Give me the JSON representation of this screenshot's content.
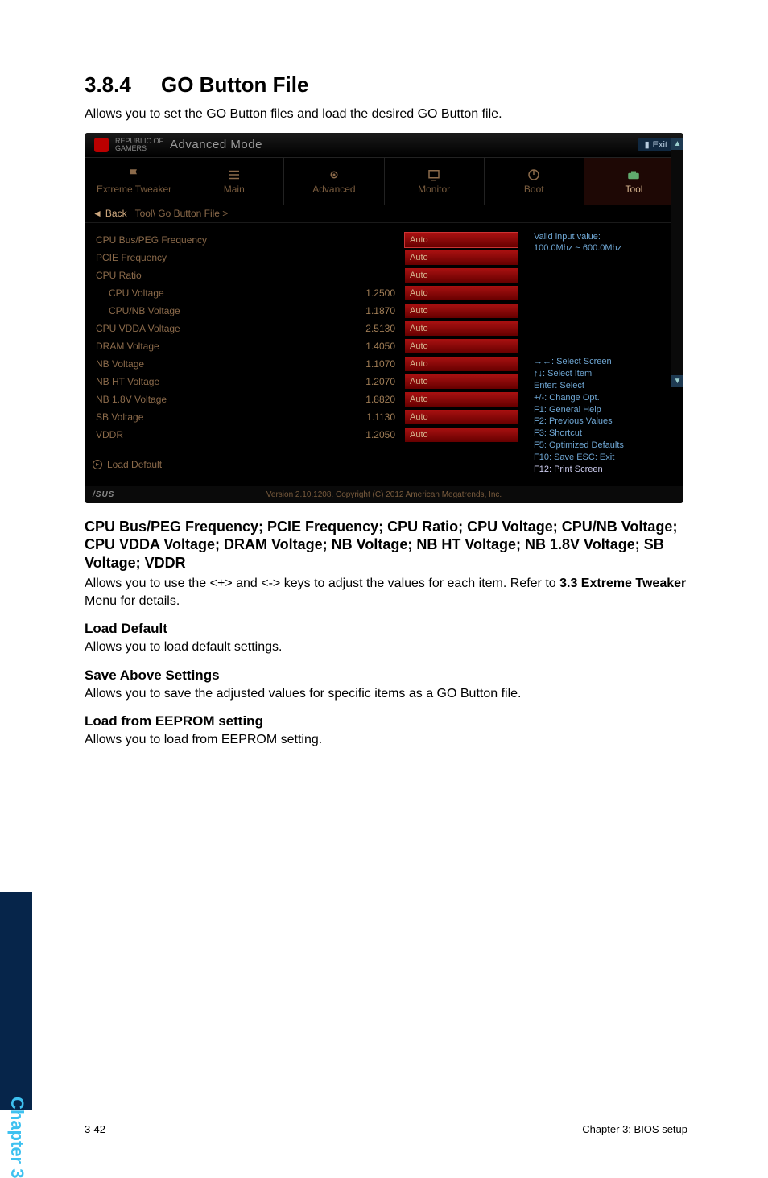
{
  "section_number": "3.8.4",
  "section_title": "GO Button File",
  "intro_text": "Allows you to set the GO Button files and load the desired GO Button file.",
  "bios": {
    "brand_line1": "REPUBLIC OF",
    "brand_line2": "GAMERS",
    "mode_label": "Advanced Mode",
    "exit_label": "Exit",
    "menu": {
      "extreme_tweaker": "Extreme Tweaker",
      "main": "Main",
      "advanced": "Advanced",
      "monitor": "Monitor",
      "boot": "Boot",
      "tool": "Tool"
    },
    "back_label": "Back",
    "breadcrumb": "Tool\\ Go Button File >",
    "rows": [
      {
        "label": "CPU Bus/PEG Frequency",
        "value": "",
        "field": "Auto",
        "indent": false,
        "active": true
      },
      {
        "label": "PCIE Frequency",
        "value": "",
        "field": "Auto",
        "indent": false
      },
      {
        "label": "CPU Ratio",
        "value": "",
        "field": "Auto",
        "indent": false
      },
      {
        "label": "CPU Voltage",
        "value": "1.2500",
        "field": "Auto",
        "indent": true
      },
      {
        "label": "CPU/NB Voltage",
        "value": "1.1870",
        "field": "Auto",
        "indent": true
      },
      {
        "label": "CPU VDDA Voltage",
        "value": "2.5130",
        "field": "Auto",
        "indent": false
      },
      {
        "label": "DRAM Voltage",
        "value": "1.4050",
        "field": "Auto",
        "indent": false
      },
      {
        "label": "NB Voltage",
        "value": "1.1070",
        "field": "Auto",
        "indent": false
      },
      {
        "label": "NB HT Voltage",
        "value": "1.2070",
        "field": "Auto",
        "indent": false
      },
      {
        "label": "NB 1.8V Voltage",
        "value": "1.8820",
        "field": "Auto",
        "indent": false
      },
      {
        "label": "SB Voltage",
        "value": "1.1130",
        "field": "Auto",
        "indent": false
      },
      {
        "label": "VDDR",
        "value": "1.2050",
        "field": "Auto",
        "indent": false
      }
    ],
    "load_default": "Load Default",
    "help_top_line1": "Valid input value:",
    "help_top_line2": "100.0Mhz ~ 600.0Mhz",
    "help_lines": [
      "→←: Select Screen",
      "↑↓: Select Item",
      "Enter: Select",
      "+/-: Change Opt.",
      "F1: General Help",
      "F2: Previous Values",
      "F3: Shortcut",
      "F5: Optimized Defaults",
      "F10: Save  ESC: Exit",
      "F12: Print Screen"
    ],
    "footer_text": "Version 2.10.1208. Copyright (C) 2012 American Megatrends, Inc.",
    "asus_text": "/SUS"
  },
  "subheading_params": "CPU Bus/PEG Frequency; PCIE Frequency; CPU Ratio; CPU Voltage; CPU/NB Voltage; CPU VDDA Voltage; DRAM Voltage; NB Voltage; NB HT Voltage; NB 1.8V Voltage; SB Voltage; VDDR",
  "params_body_pre": "Allows you to use the <+> and <-> keys to adjust the values for each item. Refer to ",
  "params_body_bold": "3.3 Extreme Tweaker",
  "params_body_post": " Menu for details.",
  "topics": [
    {
      "title": "Load Default",
      "body": "Allows you to load default settings."
    },
    {
      "title": "Save Above Settings",
      "body": "Allows you to save the adjusted values for specific items as a GO Button file."
    },
    {
      "title": "Load from EEPROM setting",
      "body": "Allows you to load from EEPROM setting."
    }
  ],
  "chapter_tab": "Chapter 3",
  "footer_left": "3-42",
  "footer_right": "Chapter 3: BIOS setup"
}
